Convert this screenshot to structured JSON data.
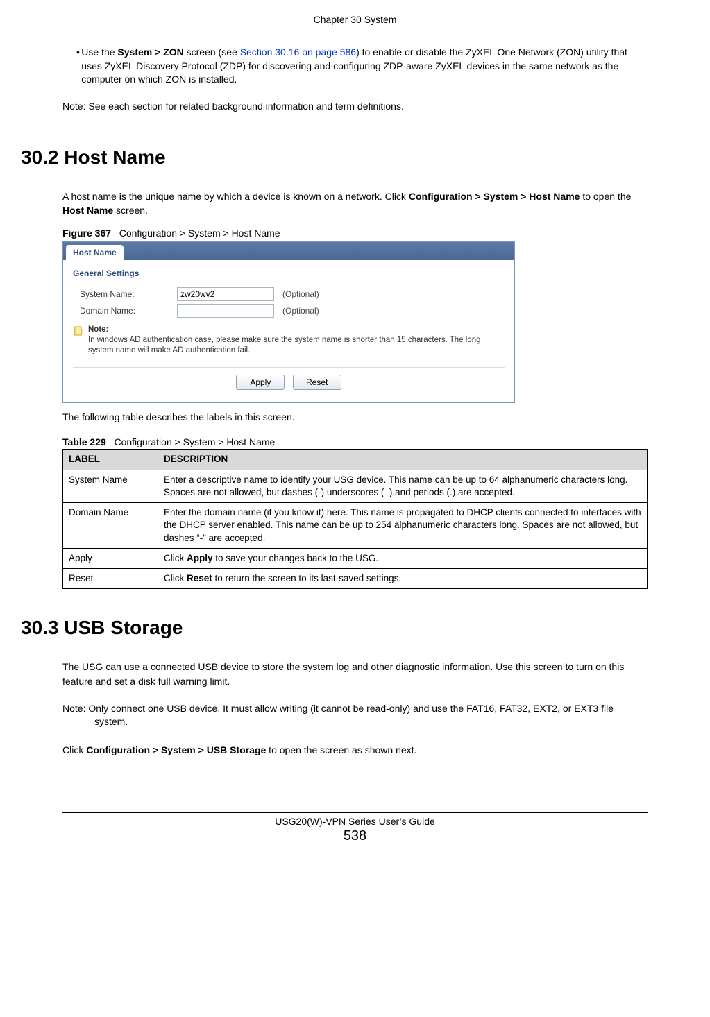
{
  "chapter_header": "Chapter 30 System",
  "intro_bullet": {
    "prefix": "Use the ",
    "bold1": "System > ZON",
    "mid1": " screen (see ",
    "link": "Section 30.16 on page 586",
    "tail": ") to enable or disable the ZyXEL One Network (ZON) utility that uses ZyXEL Discovery Protocol (ZDP) for discovering and configuring ZDP-aware ZyXEL devices in the same network as the computer on which ZON is installed."
  },
  "intro_note": "Note: See each section for related background information and term definitions.",
  "section302": {
    "heading": "30.2  Host Name",
    "para_parts": {
      "p1": "A host name is the unique name by which a device is known on a network. Click ",
      "b1": "Configuration > System > Host Name",
      "p2": " to open the ",
      "b2": "Host Name",
      "p3": " screen."
    },
    "figure_label": "Figure 367",
    "figure_caption": "Configuration > System > Host Name",
    "table_intro": "The following table describes the labels in this screen.",
    "table_label": "Table 229",
    "table_caption": "Configuration > System > Host Name",
    "table_headers": {
      "label": "LABEL",
      "desc": "DESCRIPTION"
    },
    "rows": [
      {
        "label": "System Name",
        "desc": "Enter a descriptive name to identify your USG device. This name can be up to 64 alphanumeric characters long. Spaces are not allowed, but dashes (-) underscores (_) and periods (.) are accepted."
      },
      {
        "label": "Domain Name",
        "desc": "Enter the domain name (if you know it) here. This name is propagated to DHCP clients connected to interfaces with the DHCP server enabled. This name can be up to 254 alphanumeric characters long. Spaces are not allowed, but dashes “-” are accepted."
      },
      {
        "label": "Apply",
        "desc_pre": "Click ",
        "desc_bold": "Apply",
        "desc_post": " to save your changes back to the USG."
      },
      {
        "label": "Reset",
        "desc_pre": "Click ",
        "desc_bold": "Reset",
        "desc_post": " to return the screen to its last-saved settings."
      }
    ]
  },
  "screenshot": {
    "tab": "Host Name",
    "section": "General Settings",
    "system_name_label": "System Name:",
    "system_name_value": "zw20wv2",
    "domain_name_label": "Domain Name:",
    "domain_name_value": "",
    "optional": "(Optional)",
    "note_title": "Note:",
    "note_text": "In windows AD authentication case, please make sure the system name is shorter than 15 characters. The long system name will make AD authentication fail.",
    "apply": "Apply",
    "reset": "Reset"
  },
  "section303": {
    "heading": "30.3  USB Storage",
    "para1": "The USG can use a connected USB device to store the system log and other diagnostic information. Use this screen to turn on this feature and set a disk full warning limit.",
    "note": "Note: Only connect one USB device. It must allow writing (it cannot be read-only) and use the FAT16, FAT32, EXT2, or EXT3 file system.",
    "para2_pre": "Click ",
    "para2_bold": "Configuration > System > USB Storage",
    "para2_post": " to open the screen as shown next."
  },
  "footer": {
    "guide": "USG20(W)-VPN Series User’s Guide",
    "page": "538"
  }
}
